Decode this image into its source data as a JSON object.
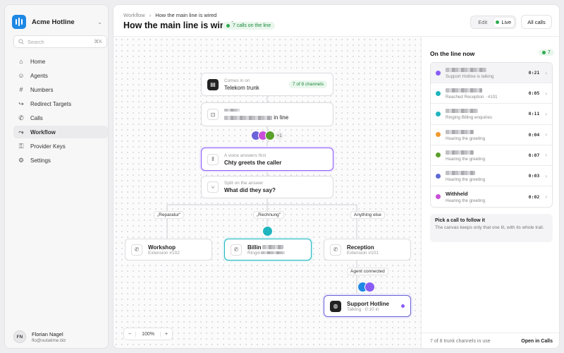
{
  "workspace": {
    "name": "Acme Hotline"
  },
  "search": {
    "placeholder": "Search",
    "shortcut": "⌘K"
  },
  "nav": [
    {
      "label": "Home",
      "icon": "home-icon"
    },
    {
      "label": "Agents",
      "icon": "users-icon"
    },
    {
      "label": "Numbers",
      "icon": "hash-icon"
    },
    {
      "label": "Redirect Targets",
      "icon": "redirect-icon"
    },
    {
      "label": "Calls",
      "icon": "phone-icon"
    },
    {
      "label": "Workflow",
      "icon": "workflow-icon",
      "active": true
    },
    {
      "label": "Provider Keys",
      "icon": "key-icon"
    },
    {
      "label": "Settings",
      "icon": "gear-icon"
    }
  ],
  "user": {
    "initials": "FN",
    "name": "Florian Nagel",
    "email": "flo@outatime.biz"
  },
  "header": {
    "breadcrumb": [
      "Workflow",
      "How the main line is wired"
    ],
    "title": "How the main line is wired",
    "calls_badge": "7 calls on the line",
    "mode": {
      "edit": "Edit",
      "live": "Live"
    },
    "all_calls": "All calls"
  },
  "flow": {
    "trunk": {
      "sub": "Comes in on",
      "title": "Telekom trunk",
      "badge": "7 of 8 channels"
    },
    "number": {
      "title_suffix": "in line"
    },
    "more_count": "+1",
    "voice": {
      "sub": "A voice answers first",
      "title": "Chty greets the caller"
    },
    "split": {
      "sub": "Split on the answer",
      "title": "What did they say?"
    },
    "branches": [
      "„Reparatur\"",
      "„Rechnung\"",
      "Anything else"
    ],
    "workshop": {
      "title": "Workshop",
      "sub": "Extension #102"
    },
    "billing": {
      "title": "Billin",
      "sub": "Ringin"
    },
    "reception": {
      "title": "Reception",
      "sub": "Extension #101"
    },
    "agent_connected": "Agent connected",
    "support": {
      "title": "Support Hotline",
      "sub": "Talking · 0:10 in"
    }
  },
  "zoom": {
    "minus": "−",
    "level": "100%",
    "plus": "+"
  },
  "panel": {
    "title": "On the line now",
    "count": "7",
    "calls": [
      {
        "color": "#8a5cf6",
        "status": "Support Hotline is talking",
        "time": "0:21",
        "selected": true
      },
      {
        "color": "#1fb5bf",
        "status": "Reached Reception · #101",
        "time": "0:05"
      },
      {
        "color": "#1fb5bf",
        "status": "Ringing Billing enquiries",
        "time": "0:11"
      },
      {
        "color": "#f29a2e",
        "status": "Hearing the greeting",
        "time": "0:04"
      },
      {
        "color": "#5aa02c",
        "status": "Hearing the greeting",
        "time": "0:07"
      },
      {
        "color": "#5c6bd6",
        "status": "Hearing the greeting",
        "time": "0:03"
      },
      {
        "color": "#c94fd8",
        "name": "Withheld",
        "status": "Hearing the greeting",
        "time": "0:02"
      }
    ],
    "hint_title": "Pick a call to follow it",
    "hint_body": "The canvas keeps only that one lit, with its whole trail.",
    "footer_left": "7 of 8 trunk channels in use",
    "footer_right": "Open in Calls"
  }
}
